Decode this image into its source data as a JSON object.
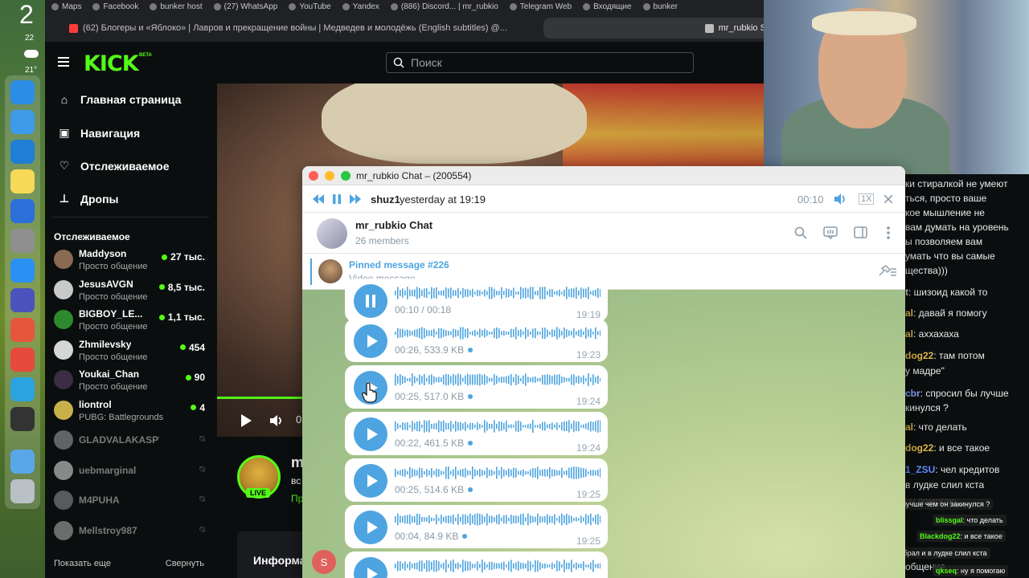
{
  "dock": {
    "clock_hour": "2",
    "date": "22",
    "temp": "21°"
  },
  "bookmarks": [
    "Maps",
    "Facebook",
    "bunker host",
    "(27) WhatsApp",
    "YouTube",
    "Yandex",
    "(886) Discord... | mr_rubkio",
    "Telegram Web",
    "Входящие",
    "bunker"
  ],
  "tabs": [
    {
      "label": "(62) Блогеры и «Яблоко» | Лавров и прекращение войны | Медведев и молодёжь (English subtitles) @..."
    },
    {
      "label": "mr_rubkio St"
    }
  ],
  "kick": {
    "logo": "KICK",
    "beta": "BETA",
    "search_placeholder": "Поиск",
    "nav": [
      {
        "label": "Главная страница",
        "icon": "home-icon"
      },
      {
        "label": "Навигация",
        "icon": "compass-icon"
      },
      {
        "label": "Отслеживаемое",
        "icon": "heart-icon"
      },
      {
        "label": "Дропы",
        "icon": "drops-icon"
      }
    ],
    "following_title": "Отслеживаемое",
    "channels": [
      {
        "name": "Maddyson",
        "category": "Просто общение",
        "viewers": "27 тыс.",
        "live": true,
        "avatar_color": "#8b6a52"
      },
      {
        "name": "JesusAVGN",
        "category": "Просто общение",
        "viewers": "8,5 тыс.",
        "live": true,
        "avatar_color": "#c9c9c9"
      },
      {
        "name": "BIGBOY_LE...",
        "category": "Просто общение",
        "viewers": "1,1 тыс.",
        "live": true,
        "avatar_color": "#2c8a2c"
      },
      {
        "name": "Zhmilevsky",
        "category": "Просто общение",
        "viewers": "454",
        "live": true,
        "avatar_color": "#d6d6d6"
      },
      {
        "name": "Youkai_Chan",
        "category": "Просто общение",
        "viewers": "90",
        "live": true,
        "avatar_color": "#3a2d44"
      },
      {
        "name": "liontrol",
        "category": "PUBG: Battlegrounds",
        "viewers": "4",
        "live": true,
        "avatar_color": "#c7b04a"
      },
      {
        "name": "GLADVALAKASPWNZ",
        "live": false,
        "avatar_color": "#aaaaaa"
      },
      {
        "name": "uebmarginal",
        "live": false,
        "avatar_color": "#eeeeee"
      },
      {
        "name": "M4PUHA",
        "live": false,
        "avatar_color": "#999999"
      },
      {
        "name": "Mellstroy987",
        "live": false,
        "avatar_color": "#bbbbbb"
      }
    ],
    "show_more": "Показать еще",
    "collapse": "Свернуть",
    "streamer_initial": "m",
    "under_line1": "вс",
    "under_line2": "Пр",
    "live_label": "LIVE",
    "info_tab": "Информа",
    "video_time": "0"
  },
  "telegram": {
    "window_title": "mr_rubkio Chat – (200554)",
    "player": {
      "sender": "shuz1",
      "when": "yesterday at 19:19",
      "time": "00:10",
      "speed": "1X"
    },
    "chat": {
      "name": "mr_rubkio Chat",
      "members": "26 members"
    },
    "pinned": {
      "title": "Pinned message #226",
      "subtitle": "Video message"
    },
    "messages": [
      {
        "meta": "00:10 / 00:18",
        "time": "19:19",
        "playing": true,
        "unread": false
      },
      {
        "meta": "00:26, 533.9 KB",
        "time": "19:23",
        "playing": false,
        "unread": true
      },
      {
        "meta": "00:25, 517.0 KB",
        "time": "19:24",
        "playing": false,
        "unread": true
      },
      {
        "meta": "00:22, 461.5 KB",
        "time": "19:24",
        "playing": false,
        "unread": true
      },
      {
        "meta": "00:25, 514.6 KB",
        "time": "19:25",
        "playing": false,
        "unread": true
      },
      {
        "meta": "00:04, 84.9 KB",
        "time": "19:25",
        "playing": false,
        "unread": true
      },
      {
        "meta": "",
        "time": "",
        "playing": false,
        "unread": false
      }
    ],
    "sender_initial": "S",
    "accent": "#4ea4e0"
  },
  "kick_chat": {
    "lines": [
      {
        "user": "",
        "text": "ки стиралкой не умеют"
      },
      {
        "user": "",
        "text": "ться, просто ваше"
      },
      {
        "user": "",
        "text": "кое мышление не"
      },
      {
        "user": "",
        "text": "вам думать на уровень"
      },
      {
        "user": "",
        "text": "ы позволяем вам"
      },
      {
        "user": "",
        "text": "умать что вы самые"
      },
      {
        "user": "",
        "text": "щества)))"
      },
      {
        "user": "t",
        "text": ": шизоид какой то",
        "color": "#c9c9c9"
      },
      {
        "user": "al",
        "text": ": давай я помогу",
        "color": "#e0b94a"
      },
      {
        "user": "al",
        "text": ": аххахаха",
        "color": "#e0b94a"
      },
      {
        "user": "dog22",
        "text": ": там потом",
        "color": "#e0b94a"
      },
      {
        "user": "",
        "text": "у мадре\""
      },
      {
        "user": "cbr",
        "text": ": спросил бы лучше",
        "color": "#8aa6ff"
      },
      {
        "user": "",
        "text": "кинулся ?"
      },
      {
        "user": "al",
        "text": ": что делать",
        "color": "#e0b94a"
      },
      {
        "user": "dog22",
        "text": ": и все такое",
        "color": "#e0b94a"
      },
      {
        "user": "1_ZSU",
        "text": ": чел кредитов",
        "color": "#5f8dff"
      },
      {
        "user": "",
        "text": "в лудке слил кста"
      },
      {
        "user": "",
        "text": "ру помогаю"
      },
      {
        "user": "",
        "text": "общение"
      }
    ],
    "overlay": [
      {
        "user": "dimonebr",
        "text": ": спросил бы лучше чем он закинулся ?"
      },
      {
        "user": "blissgal",
        "text": ": что делать"
      },
      {
        "user": "Blackdog22",
        "text": ": и все такое"
      },
      {
        "user": "1921_ZSU",
        "text": ": чел кредитов набрал и в лудке слил кста"
      },
      {
        "user": "qkseq",
        "text": ": ну я помогаю"
      }
    ]
  }
}
